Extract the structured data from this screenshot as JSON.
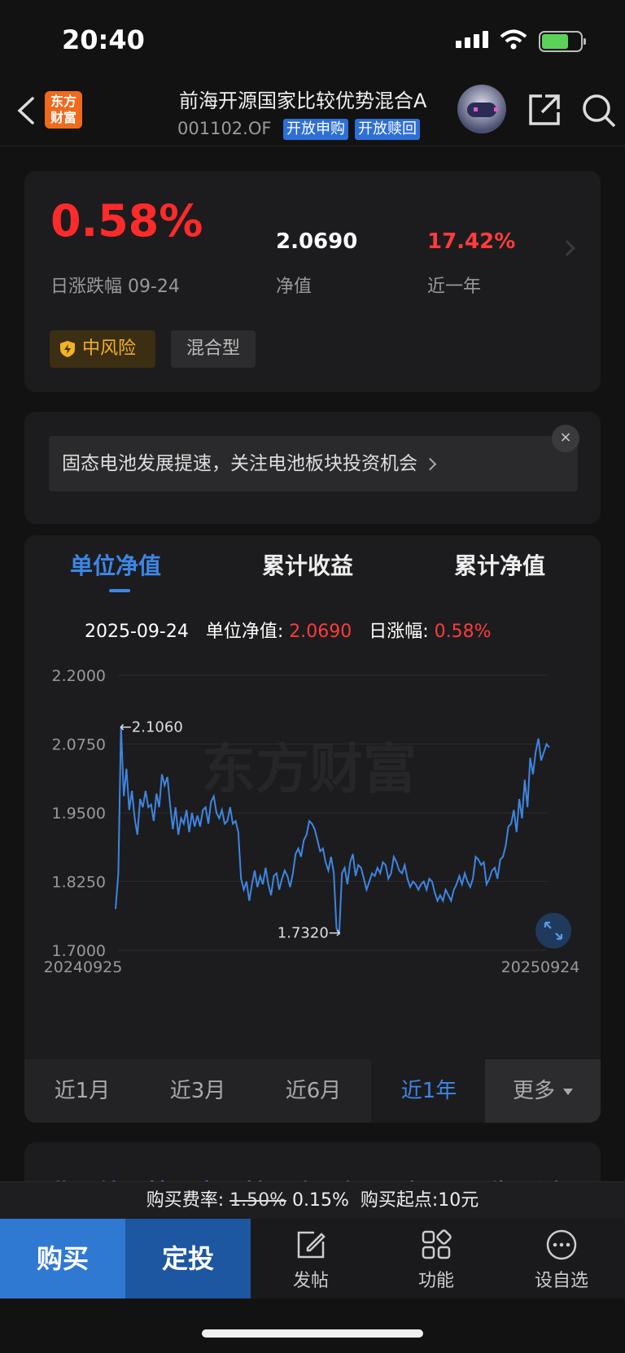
{
  "status": {
    "time": "20:40"
  },
  "header": {
    "logo_line1": "东方",
    "logo_line2": "财富",
    "title": "前海开源国家比较优势混合A",
    "code": "001102.OF",
    "tag_subscribe": "开放申购",
    "tag_redeem": "开放赎回"
  },
  "summary": {
    "daily_change": "0.58%",
    "daily_change_label": "日涨跌幅 09-24",
    "nav": "2.0690",
    "nav_label": "净值",
    "year_return": "17.42%",
    "year_label": "近一年",
    "risk_tag": "中风险",
    "type_tag": "混合型",
    "colors": {
      "up": "#ff2a2a",
      "risk": "#f3b126"
    }
  },
  "news": {
    "text": "固态电池发展提速，关注电池板块投资机会",
    "close": "×"
  },
  "chart_tabs": [
    "单位净值",
    "累计收益",
    "累计净值"
  ],
  "chart_info": {
    "date": "2025-09-24",
    "nav_label": "单位净值:",
    "nav_value": "2.0690",
    "chg_label": "日涨幅:",
    "chg_value": "0.58%"
  },
  "chart_data": {
    "type": "line",
    "x_start_label": "20240925",
    "x_end_label": "20250924",
    "y_ticks": [
      "2.2000",
      "2.0750",
      "1.9500",
      "1.8250",
      "1.7000"
    ],
    "ylim": [
      1.7,
      2.2
    ],
    "max_annotation": "←2.1060",
    "min_annotation": "1.7320→",
    "watermark": "东方财富",
    "series": [
      {
        "values": [
          1.775,
          1.84,
          2.106,
          1.98,
          2.03,
          1.955,
          1.99,
          1.94,
          1.91,
          1.975,
          1.96,
          1.99,
          1.96,
          1.965,
          1.935,
          1.985,
          1.96,
          2.02,
          2.0,
          2.015,
          1.965,
          1.92,
          1.96,
          1.91,
          1.94,
          1.93,
          1.955,
          1.915,
          1.95,
          1.925,
          1.945,
          1.925,
          1.955,
          1.96,
          1.93,
          1.97,
          1.98,
          1.95,
          1.94,
          1.955,
          1.93,
          1.935,
          1.96,
          1.93,
          1.935,
          1.915,
          1.83,
          1.81,
          1.825,
          1.79,
          1.82,
          1.845,
          1.815,
          1.835,
          1.82,
          1.85,
          1.82,
          1.8,
          1.835,
          1.84,
          1.81,
          1.83,
          1.845,
          1.835,
          1.815,
          1.84,
          1.875,
          1.885,
          1.87,
          1.9,
          1.91,
          1.935,
          1.93,
          1.92,
          1.9,
          1.88,
          1.885,
          1.86,
          1.845,
          1.87,
          1.84,
          1.74,
          1.732,
          1.84,
          1.85,
          1.82,
          1.86,
          1.875,
          1.835,
          1.855,
          1.85,
          1.83,
          1.81,
          1.825,
          1.84,
          1.835,
          1.85,
          1.84,
          1.86,
          1.855,
          1.83,
          1.84,
          1.87,
          1.86,
          1.845,
          1.84,
          1.855,
          1.83,
          1.815,
          1.825,
          1.82,
          1.81,
          1.82,
          1.825,
          1.81,
          1.83,
          1.825,
          1.805,
          1.79,
          1.8,
          1.79,
          1.81,
          1.8,
          1.79,
          1.81,
          1.82,
          1.835,
          1.82,
          1.84,
          1.825,
          1.815,
          1.83,
          1.87,
          1.865,
          1.855,
          1.86,
          1.82,
          1.83,
          1.845,
          1.85,
          1.83,
          1.865,
          1.87,
          1.89,
          1.925,
          1.93,
          1.955,
          1.915,
          1.975,
          1.94,
          2.01,
          1.96,
          2.05,
          2.02,
          2.06,
          2.085,
          2.045,
          2.06,
          2.075,
          2.069
        ]
      }
    ]
  },
  "ranges": [
    "近1月",
    "近3月",
    "近6月",
    "近1年",
    "更多"
  ],
  "lower_tabs_peek": "业绩档案持仓规则公告讨论",
  "fee": {
    "label": "购买费率:",
    "original": "1.50%",
    "current": "0.15%",
    "min_label": "购买起点:10元"
  },
  "actions": {
    "buy": "购买",
    "plan": "定投",
    "post": "发帖",
    "functions": "功能",
    "watchlist": "设自选"
  }
}
